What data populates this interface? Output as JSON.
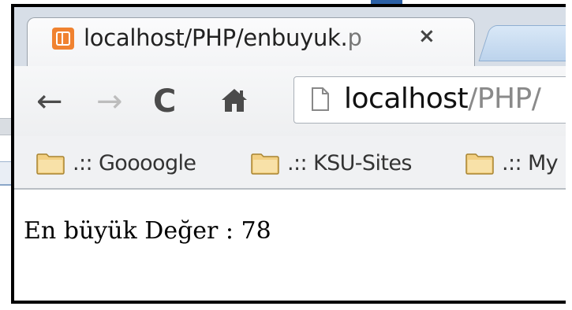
{
  "browser": {
    "tab": {
      "title_main": "localhost/PHP/enbuyuk.",
      "title_fade": "p",
      "close_glyph": "×"
    },
    "toolbar": {
      "back_glyph": "←",
      "forward_glyph": "→",
      "reload_glyph": "C",
      "url_host": "localhost",
      "url_path": "/PHP/"
    },
    "bookmarks": [
      {
        "label": ".:: Goooogle"
      },
      {
        "label": ".:: KSU-Sites"
      },
      {
        "label": ".:: My"
      }
    ]
  },
  "page": {
    "text": "En büyük Değer : 78"
  },
  "colors": {
    "favicon": "#f08230",
    "frame": "#000000",
    "folder": "#f3d083",
    "new_tab": "#bcd3ec"
  }
}
